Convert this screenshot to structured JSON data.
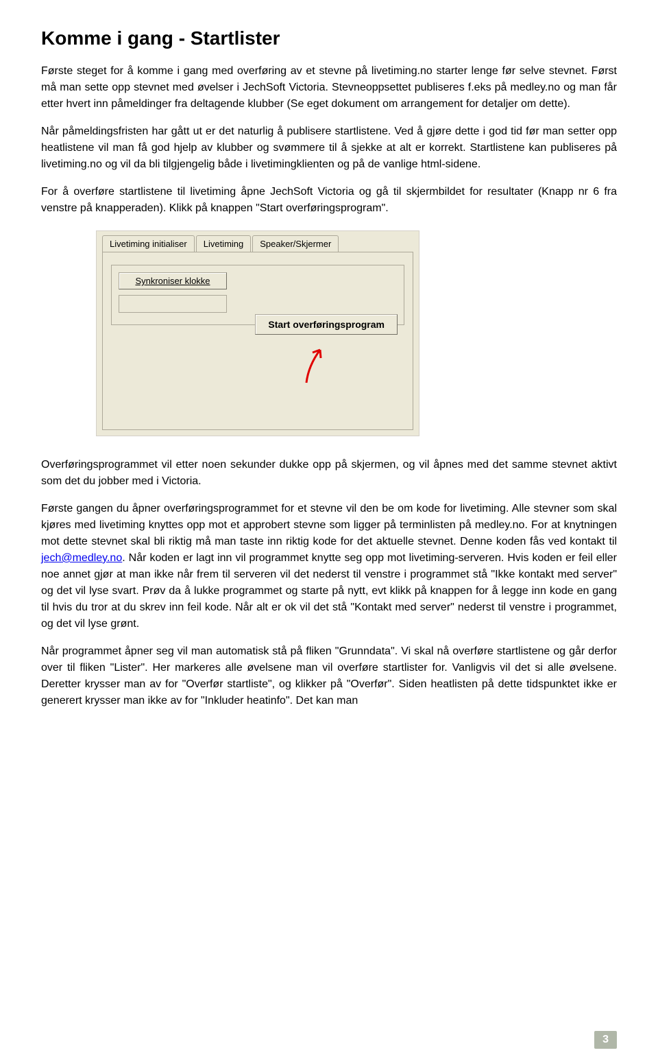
{
  "heading": "Komme i gang - Startlister",
  "para1": "Første steget for å komme i gang med overføring av et stevne på livetiming.no starter lenge før selve stevnet. Først må man sette opp stevnet med øvelser i JechSoft Victoria. Stevneoppsettet publiseres f.eks på medley.no og man får etter hvert inn påmeldinger fra deltagende klubber (Se eget dokument om arrangement for detaljer om dette).",
  "para2": "Når påmeldingsfristen har gått ut er det naturlig å publisere startlistene. Ved å gjøre dette i god tid før man setter opp heatlistene vil man få god hjelp av klubber og svømmere til å sjekke at alt er korrekt. Startlistene kan publiseres på livetiming.no og vil da bli tilgjengelig både i livetimingklienten og på de vanlige html-sidene.",
  "para3": "For å overføre startlistene til livetiming åpne JechSoft Victoria og gå til skjermbildet for resultater (Knapp nr 6 fra venstre på knapperaden). Klikk på knappen \"Start overføringsprogram\".",
  "screenshot": {
    "tabs": {
      "tab1": "Livetiming initialiser",
      "tab2": "Livetiming",
      "tab3": "Speaker/Skjermer"
    },
    "btn_sync": "Synkroniser klokke",
    "btn_start": "Start overføringsprogram"
  },
  "para4": "Overføringsprogrammet vil etter noen sekunder dukke opp på skjermen, og vil åpnes med det samme stevnet aktivt som det du jobber med i Victoria.",
  "para5_a": "Første gangen du åpner overføringsprogrammet for et stevne vil den be om kode for livetiming. Alle stevner som skal kjøres med livetiming knyttes opp mot et approbert stevne som ligger på terminlisten på medley.no. For at knytningen mot dette stevnet skal bli riktig må man taste inn riktig kode for det aktuelle stevnet. Denne koden fås ved kontakt til ",
  "email": "jech@medley.no",
  "para5_b": ". Når koden er lagt inn vil programmet knytte seg opp mot livetiming-serveren. Hvis koden er feil eller noe annet gjør at man ikke når frem til serveren vil det nederst til venstre i programmet stå \"Ikke kontakt med server\" og det vil lyse svart. Prøv da å lukke programmet og starte på nytt, evt klikk på knappen for å legge inn kode en gang til hvis du tror at du skrev inn feil kode. Når alt er ok vil det stå \"Kontakt med server\" nederst til venstre i programmet, og det vil lyse grønt.",
  "para6": "Når programmet åpner seg vil man automatisk stå på fliken \"Grunndata\". Vi skal nå overføre startlistene og går derfor over til fliken \"Lister\". Her markeres alle øvelsene man vil overføre startlister for. Vanligvis vil det si alle øvelsene. Deretter krysser man av for \"Overfør startliste\", og klikker på \"Overfør\". Siden heatlisten på dette tidspunktet ikke er generert krysser man ikke av for \"Inkluder heatinfo\". Det kan man",
  "page_number": "3"
}
